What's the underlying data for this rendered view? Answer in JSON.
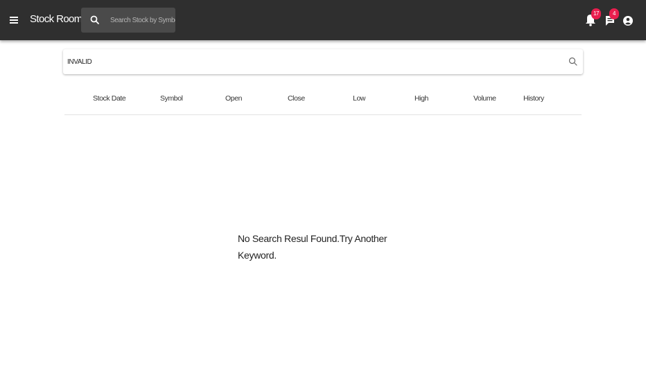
{
  "appbar": {
    "title": "Stock Room",
    "search_placeholder": "Search Stock by Symbol",
    "notifications_count": "17",
    "messages_count": "4"
  },
  "search": {
    "value": "INVALID"
  },
  "table": {
    "columns": [
      "Stock Date",
      "Symbol",
      "Open",
      "Close",
      "Low",
      "High",
      "Volume",
      "History"
    ]
  },
  "empty_message": "No Search Resul Found.Try Another Keyword.",
  "colors": {
    "appbar_bg": "#2f2f2f",
    "badge": "#e91e4e"
  },
  "icons": [
    "menu-icon",
    "search-icon",
    "bell-icon",
    "chat-icon",
    "account-icon"
  ]
}
